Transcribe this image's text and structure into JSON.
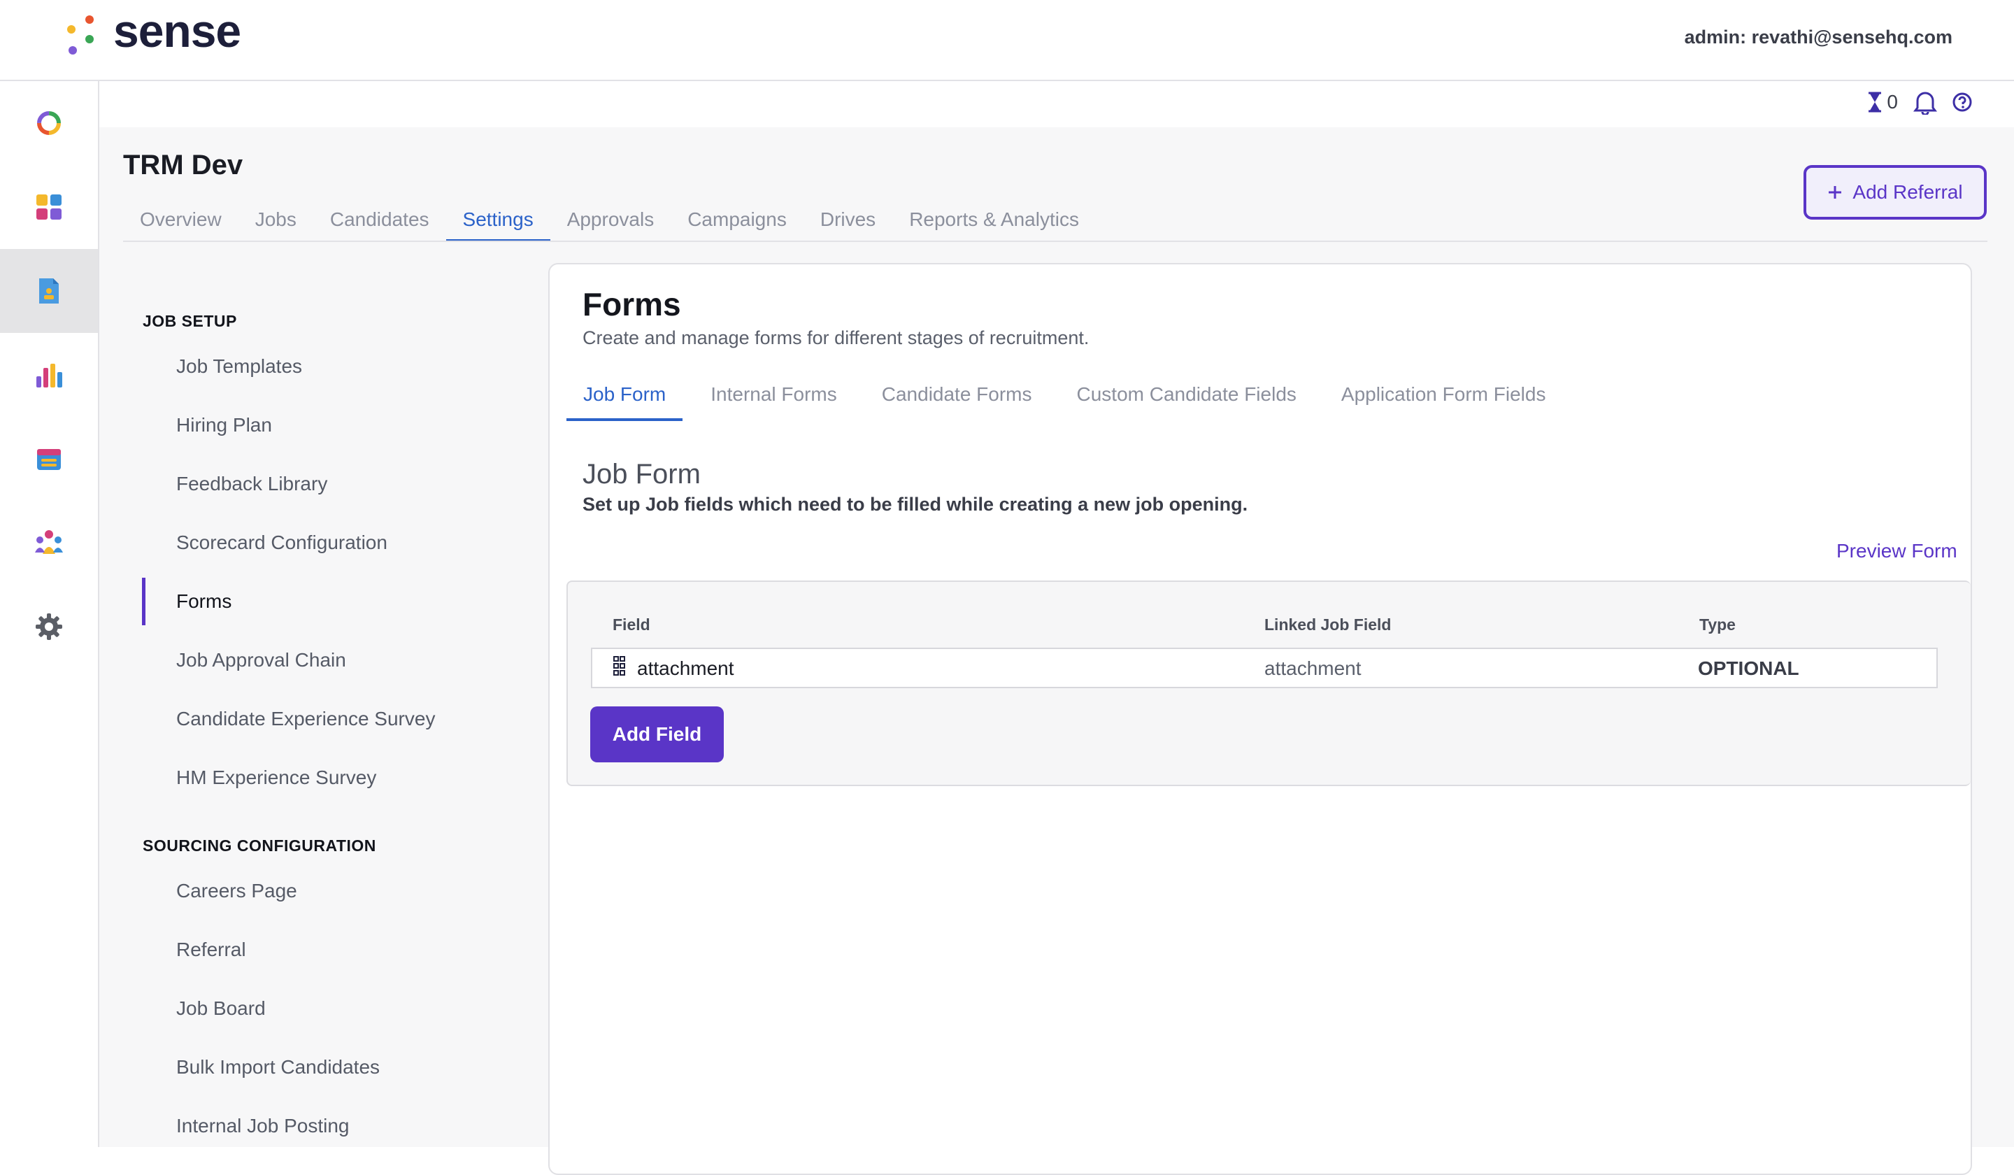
{
  "header": {
    "logo_text": "sense",
    "admin": "admin: revathi@sensehq.com"
  },
  "utility": {
    "timer_count": "0"
  },
  "page": {
    "title": "TRM Dev",
    "tabs": [
      "Overview",
      "Jobs",
      "Candidates",
      "Settings",
      "Approvals",
      "Campaigns",
      "Drives",
      "Reports & Analytics"
    ],
    "active_tab": "Settings",
    "add_referral_label": "Add Referral"
  },
  "sidebar": {
    "section1": {
      "heading": "JOB SETUP",
      "items": [
        "Job Templates",
        "Hiring Plan",
        "Feedback Library",
        "Scorecard Configuration",
        "Forms",
        "Job Approval Chain",
        "Candidate Experience Survey",
        "HM Experience Survey"
      ]
    },
    "section2": {
      "heading": "SOURCING CONFIGURATION",
      "items": [
        "Careers Page",
        "Referral",
        "Job Board",
        "Bulk Import Candidates",
        "Internal Job Posting"
      ]
    },
    "active_item": "Forms"
  },
  "forms": {
    "title": "Forms",
    "subtitle": "Create and manage forms for different stages of recruitment.",
    "tabs": [
      "Job Form",
      "Internal Forms",
      "Candidate Forms",
      "Custom Candidate Fields",
      "Application Form Fields"
    ],
    "active_tab": "Job Form"
  },
  "job_form": {
    "title": "Job Form",
    "subtitle": "Set up Job fields which need to be filled while creating a new job opening.",
    "preview_label": "Preview Form",
    "columns": {
      "field": "Field",
      "linked": "Linked Job Field",
      "type": "Type"
    },
    "rows": [
      {
        "field": "attachment",
        "linked": "attachment",
        "type": "OPTIONAL"
      }
    ],
    "add_field_label": "Add Field"
  },
  "colors": {
    "accent": "#5a35c7",
    "tab_active": "#2b62c9"
  }
}
